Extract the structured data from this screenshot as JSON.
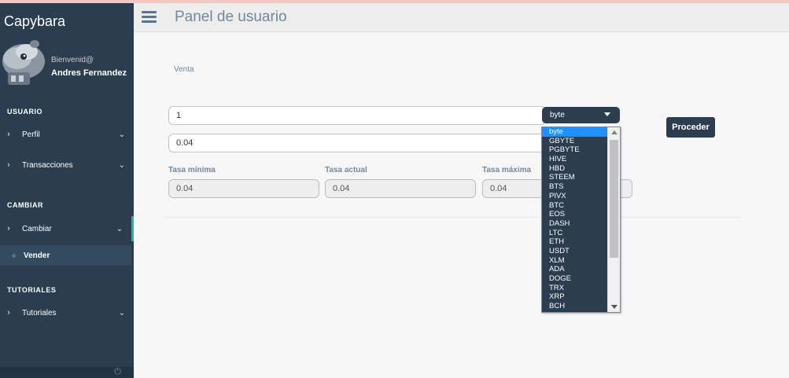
{
  "app": {
    "brand": "Capybara",
    "welcome": "Bienvenid@",
    "user_name": "Andres Fernandez"
  },
  "sidebar": {
    "sections": [
      {
        "title": "USUARIO",
        "items": [
          {
            "label": "Perfil"
          },
          {
            "label": "Transacciones"
          }
        ]
      },
      {
        "title": "CAMBIAR",
        "items": [
          {
            "label": "Cambiar",
            "sub": [
              {
                "label": "Vender"
              }
            ]
          }
        ]
      },
      {
        "title": "TUTORIALES",
        "items": [
          {
            "label": "Tutoriales"
          }
        ]
      }
    ],
    "accent_color": "#1abb9c"
  },
  "header": {
    "title": "Panel de usuario"
  },
  "form": {
    "section_label": "Venta",
    "amount_value": "1",
    "result_value": "0.04",
    "currency_selected": "byte",
    "currency_options": [
      "byte",
      "GBYTE",
      "PGBYTE",
      "HIVE",
      "HBD",
      "STEEM",
      "BTS",
      "PIVX",
      "BTC",
      "EOS",
      "DASH",
      "LTC",
      "ETH",
      "USDT",
      "XLM",
      "ADA",
      "DOGE",
      "TRX",
      "XRP",
      "BCH"
    ],
    "rates": {
      "min_label": "Tasa mínima",
      "min_value": "0.04",
      "current_label": "Tasa actual",
      "current_value": "0.04",
      "max_label": "Tasa máxima",
      "max_value": "0.04"
    },
    "submit_label": "Proceder"
  }
}
